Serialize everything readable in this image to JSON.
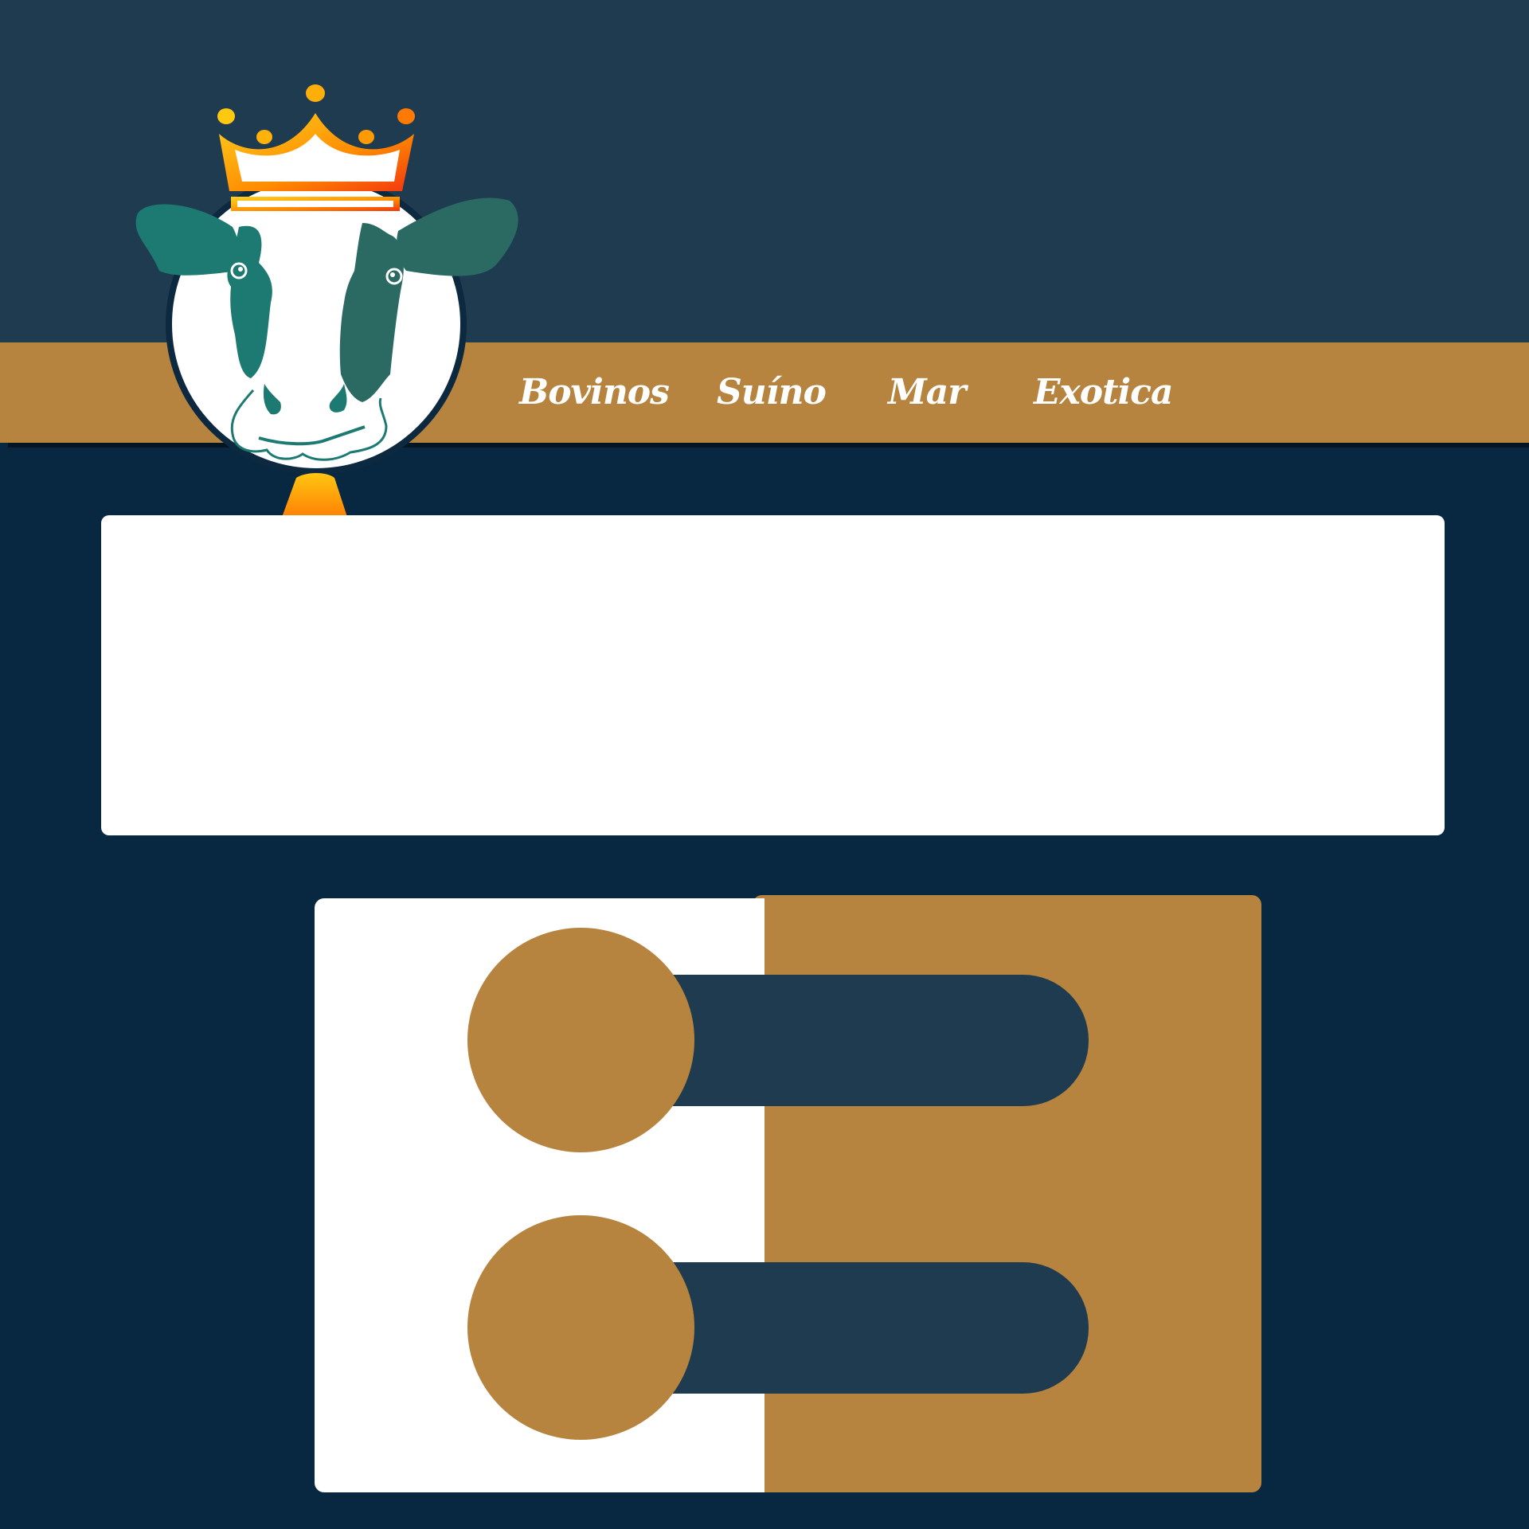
{
  "nav": {
    "items": [
      {
        "label": "Bovinos"
      },
      {
        "label": "Suíno"
      },
      {
        "label": "Mar"
      },
      {
        "label": "Exotica"
      }
    ]
  },
  "logo": {
    "icon": "crowned-cow-icon",
    "bell_icon": "cowbell-icon"
  },
  "colors": {
    "header": "#1e3b50",
    "page_background": "#082841",
    "accent_gold": "#b6843e",
    "panel": "#ffffff",
    "cow_teal": "#1b7a72"
  },
  "toggles": [
    {
      "state": "off"
    },
    {
      "state": "off"
    }
  ]
}
